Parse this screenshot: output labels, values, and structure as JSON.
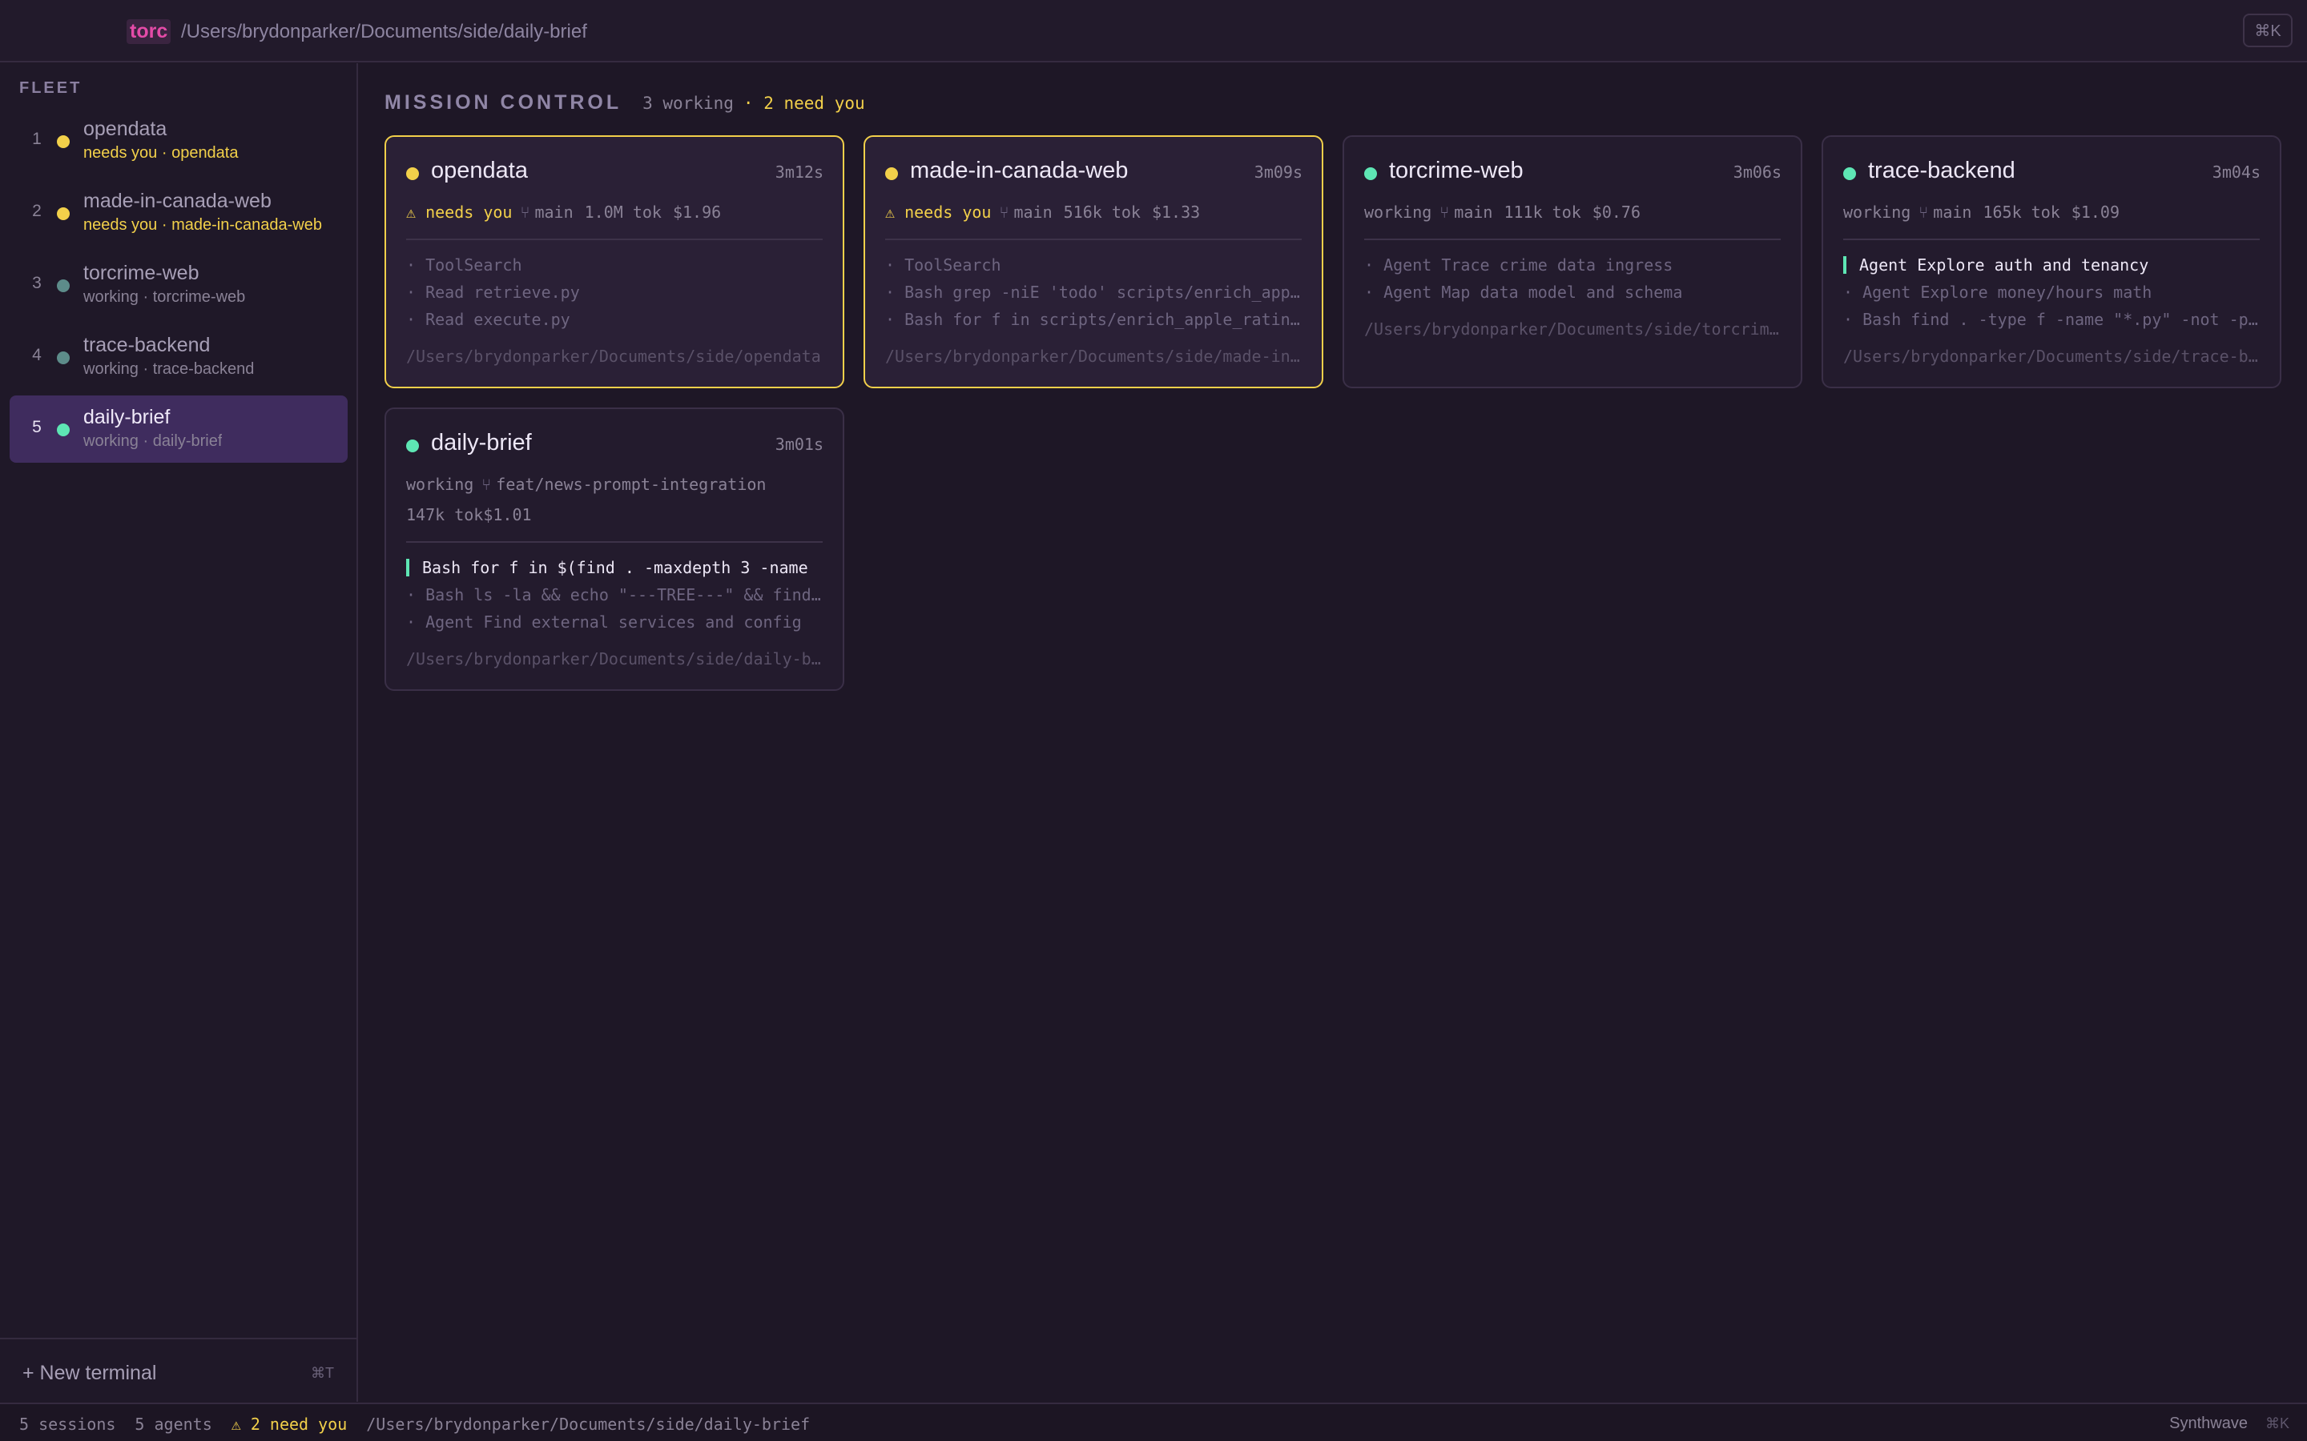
{
  "topbar": {
    "brand": "torc",
    "path": "/Users/brydonparker/Documents/side/daily-brief",
    "shortcut": "⌘K"
  },
  "sidebar": {
    "heading": "FLEET",
    "items": [
      {
        "num": "1",
        "name": "opendata",
        "sub": "needs you · opendata",
        "status": "needs",
        "dot_color": "#f2d04a"
      },
      {
        "num": "2",
        "name": "made-in-canada-web",
        "sub": "needs you · made-in-canada-web",
        "status": "needs",
        "dot_color": "#f2d04a"
      },
      {
        "num": "3",
        "name": "torcrime-web",
        "sub": "working · torcrime-web",
        "status": "working",
        "dot_color": "#5d8c8a"
      },
      {
        "num": "4",
        "name": "trace-backend",
        "sub": "working · trace-backend",
        "status": "working",
        "dot_color": "#5d8c8a"
      },
      {
        "num": "5",
        "name": "daily-brief",
        "sub": "working · daily-brief",
        "status": "working",
        "dot_color": "#5ee6b4",
        "selected": true
      }
    ],
    "new_terminal_label": "+ New terminal",
    "new_terminal_shortcut": "⌘T"
  },
  "main": {
    "title": "MISSION CONTROL",
    "working_count": "3 working",
    "need_count": "· 2 need you",
    "cards": [
      {
        "name": "opendata",
        "time": "3m12s",
        "status": "⚠ needs you",
        "branch": "main",
        "tokens": "1.0M tok",
        "cost": "$1.96",
        "lines": [
          "· ToolSearch",
          "· Read retrieve.py",
          "· Read execute.py"
        ],
        "path": "/Users/brydonparker/Documents/side/opendata"
      },
      {
        "name": "made-in-canada-web",
        "time": "3m09s",
        "status": "⚠ needs you",
        "branch": "main",
        "tokens": "516k tok",
        "cost": "$1.33",
        "lines": [
          "· ToolSearch",
          "· Bash grep -niE 'todo' scripts/enrich_apple_ratings.py",
          "· Bash for f in scripts/enrich_apple_ratings.py"
        ],
        "path": "/Users/brydonparker/Documents/side/made-in-canada-web"
      },
      {
        "name": "torcrime-web",
        "time": "3m06s",
        "status": "working",
        "branch": "main",
        "tokens": "111k tok",
        "cost": "$0.76",
        "lines": [
          "· Agent Trace crime data ingress",
          "· Agent Map data model and schema"
        ],
        "path": "/Users/brydonparker/Documents/side/torcrime-web"
      },
      {
        "name": "trace-backend",
        "time": "3m04s",
        "status": "working",
        "branch": "main",
        "tokens": "165k tok",
        "cost": "$1.09",
        "active_line": "Agent Explore auth and tenancy",
        "lines": [
          "· Agent Explore money/hours math",
          "· Bash find . -type f -name \"*.py\" -not -path"
        ],
        "path": "/Users/brydonparker/Documents/side/trace-backend"
      },
      {
        "name": "daily-brief",
        "time": "3m01s",
        "status": "working",
        "branch": "feat/news-prompt-integration",
        "tokens": "147k tok",
        "cost": "$1.01",
        "active_line": "Bash for f in $(find . -maxdepth 3 -name",
        "lines": [
          "· Bash ls -la && echo \"---TREE---\" && find .",
          "· Agent Find external services and config"
        ],
        "path": "/Users/brydonparker/Documents/side/daily-brief"
      }
    ]
  },
  "statusbar": {
    "sessions": "5 sessions",
    "agents": "5 agents",
    "need": "⚠ 2 need you",
    "path": "/Users/brydonparker/Documents/side/daily-brief",
    "theme": "Synthwave",
    "shortcut": "⌘K"
  },
  "colors": {
    "background": "#1e1726",
    "accent_pink": "#e44ba8",
    "needs_yellow": "#f2d04a",
    "working_green": "#5ee6b4",
    "selected_bg": "#3f2c5e"
  },
  "icons": {
    "branch": "git-branch-icon",
    "warning": "warning-icon",
    "status_dot": "status-dot-icon"
  }
}
